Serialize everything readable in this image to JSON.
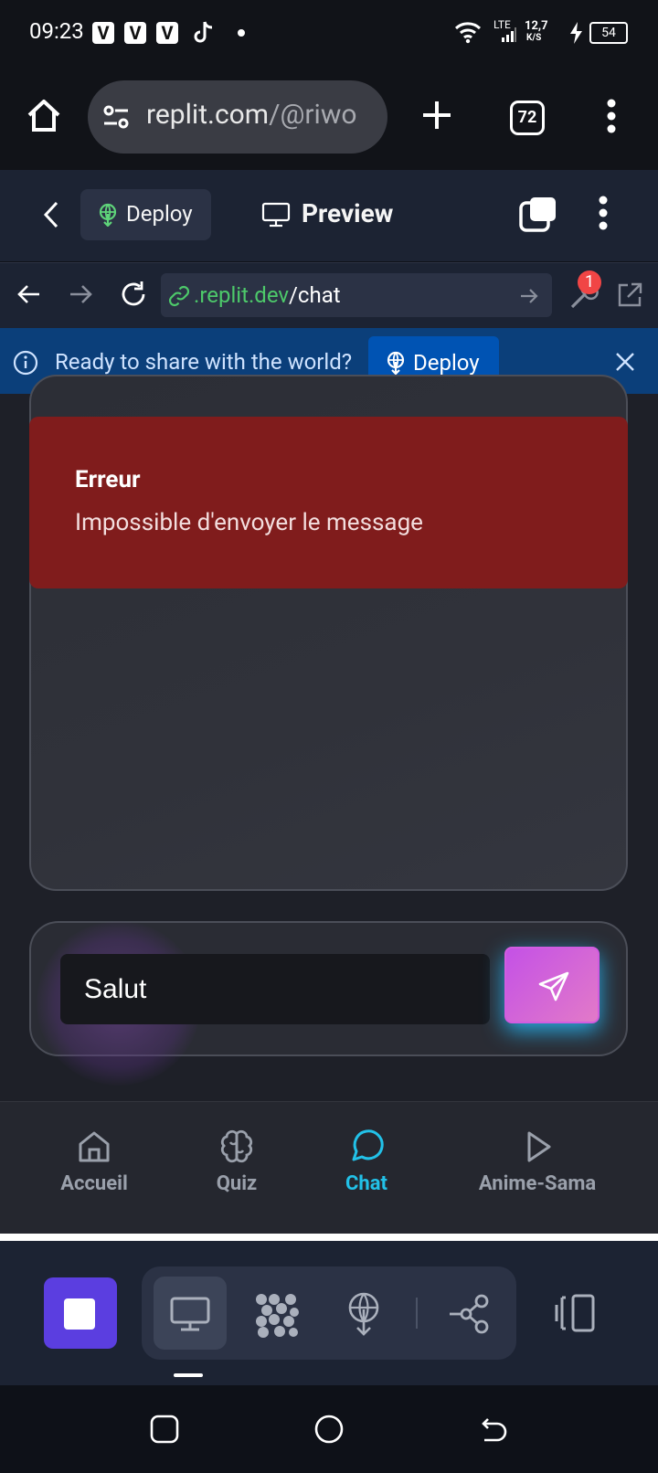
{
  "status_bar": {
    "time": "09:23",
    "notification_icons": [
      "V",
      "V",
      "V"
    ],
    "network": "LTE",
    "speed_value": "12,7",
    "speed_unit": "K/S",
    "battery": "54"
  },
  "browser": {
    "url_main": "replit.com",
    "url_dim": "/@riwo",
    "tab_count": "72"
  },
  "replit_header": {
    "deploy_label": "Deploy",
    "preview_label": "Preview"
  },
  "address_bar": {
    "url_domain": ".replit.dev",
    "url_path": "/chat",
    "badge_count": "1"
  },
  "share_banner": {
    "text": "Ready to share with the world?",
    "deploy_label": "Deploy"
  },
  "error": {
    "title": "Erreur",
    "message": "Impossible d'envoyer le message"
  },
  "chat_input": {
    "value": "Salut"
  },
  "bottom_nav": {
    "items": [
      {
        "label": "Accueil",
        "icon": "home-icon"
      },
      {
        "label": "Quiz",
        "icon": "brain-icon"
      },
      {
        "label": "Chat",
        "icon": "message-circle-icon",
        "active": true
      },
      {
        "label": "Anime-Sama",
        "icon": "play-icon"
      }
    ],
    "active_color": "#22c1e8"
  },
  "colors": {
    "error_bg": "#801c1c",
    "stop_button": "#5b3ee0",
    "share_banner": "#0b3f7a"
  }
}
